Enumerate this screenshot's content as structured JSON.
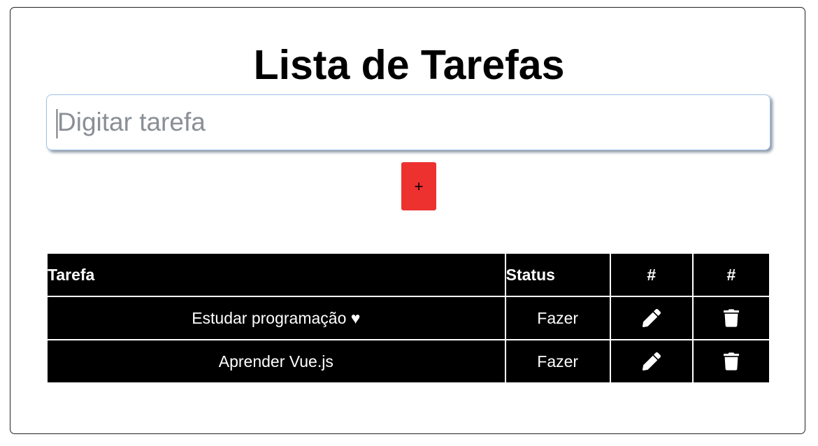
{
  "page": {
    "title": "Lista de Tarefas"
  },
  "input": {
    "placeholder": "Digitar tarefa",
    "value": ""
  },
  "add_button": {
    "label": "+",
    "color": "#ec312f"
  },
  "table": {
    "headers": {
      "task": "Tarefa",
      "status": "Status",
      "edit": "#",
      "delete": "#"
    },
    "rows": [
      {
        "task": "Estudar programação ♥",
        "status": "Fazer",
        "edit_icon": "pencil-icon",
        "delete_icon": "trash-icon"
      },
      {
        "task": "Aprender Vue.js",
        "status": "Fazer",
        "edit_icon": "pencil-icon",
        "delete_icon": "trash-icon"
      }
    ]
  },
  "colors": {
    "status_text": "#dc3545",
    "table_bg": "#000000"
  }
}
